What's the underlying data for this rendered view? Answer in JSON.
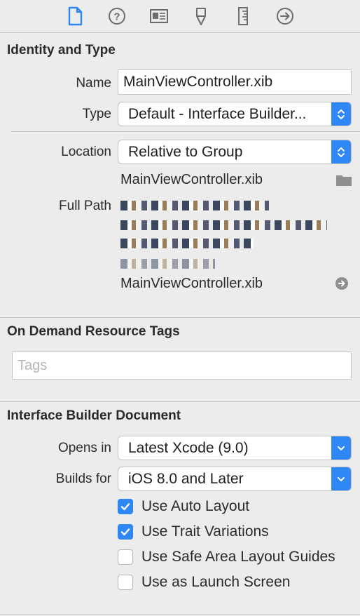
{
  "tabs": [
    {
      "icon": "file-icon",
      "selected": true
    },
    {
      "icon": "help-icon",
      "selected": false
    },
    {
      "icon": "identity-card-icon",
      "selected": false
    },
    {
      "icon": "attributes-icon",
      "selected": false
    },
    {
      "icon": "ruler-icon",
      "selected": false
    },
    {
      "icon": "connections-icon",
      "selected": false
    }
  ],
  "identity": {
    "title": "Identity and Type",
    "name_label": "Name",
    "name_value": "MainViewController.xib",
    "type_label": "Type",
    "type_value": "Default - Interface Builder...",
    "location_label": "Location",
    "location_value": "Relative to Group",
    "location_file": "MainViewController.xib",
    "full_path_label": "Full Path",
    "full_path_file": "MainViewController.xib"
  },
  "tags": {
    "title": "On Demand Resource Tags",
    "placeholder": "Tags"
  },
  "ib": {
    "title": "Interface Builder Document",
    "opens_in_label": "Opens in",
    "opens_in_value": "Latest Xcode (9.0)",
    "builds_for_label": "Builds for",
    "builds_for_value": "iOS 8.0 and Later",
    "checkboxes": [
      {
        "label": "Use Auto Layout",
        "checked": true
      },
      {
        "label": "Use Trait Variations",
        "checked": true
      },
      {
        "label": "Use Safe Area Layout Guides",
        "checked": false
      },
      {
        "label": "Use as Launch Screen",
        "checked": false
      }
    ]
  },
  "colors": {
    "accent": "#2f86f5",
    "icon_gray": "#6d6d6d"
  }
}
